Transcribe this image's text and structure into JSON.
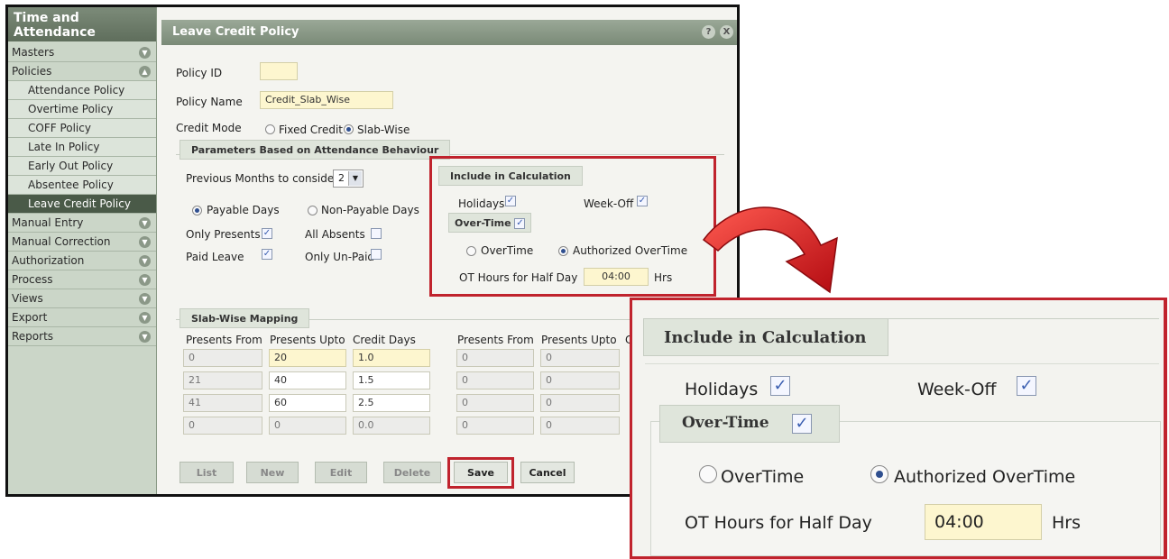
{
  "sidebar": {
    "title": "Time and Attendance",
    "items": [
      {
        "label": "Masters"
      },
      {
        "label": "Policies"
      },
      {
        "label": "Attendance Policy"
      },
      {
        "label": "Overtime Policy"
      },
      {
        "label": "COFF Policy"
      },
      {
        "label": "Late In Policy"
      },
      {
        "label": "Early Out Policy"
      },
      {
        "label": "Absentee Policy"
      },
      {
        "label": "Leave Credit Policy"
      },
      {
        "label": "Manual Entry"
      },
      {
        "label": "Manual Correction"
      },
      {
        "label": "Authorization"
      },
      {
        "label": "Process"
      },
      {
        "label": "Views"
      },
      {
        "label": "Export"
      },
      {
        "label": "Reports"
      }
    ]
  },
  "panel": {
    "title": "Leave Credit Policy",
    "help_icon": "?",
    "close_icon": "X"
  },
  "form": {
    "policy_id_label": "Policy ID",
    "policy_id_value": "",
    "policy_name_label": "Policy Name",
    "policy_name_value": "Credit_Slab_Wise",
    "credit_mode_label": "Credit Mode",
    "fixed_credit": "Fixed Credit",
    "slab_wise": "Slab-Wise"
  },
  "params": {
    "section_title": "Parameters Based on Attendance Behaviour",
    "prev_months_label": "Previous Months to consider",
    "prev_months_value": "2",
    "payable_days": "Payable Days",
    "non_payable_days": "Non-Payable Days",
    "only_presents": "Only Presents",
    "all_absents": "All Absents",
    "paid_leave": "Paid Leave",
    "only_unpaid": "Only Un-Paid"
  },
  "include": {
    "title": "Include in Calculation",
    "holidays": "Holidays",
    "week_off": "Week-Off",
    "overtime_title": "Over-Time",
    "overtime": "OverTime",
    "authorized_overtime": "Authorized OverTime",
    "ot_half_day_label": "OT Hours for Half Day",
    "ot_half_day_value": "04:00",
    "hrs": "Hrs"
  },
  "slab": {
    "section_title": "Slab-Wise Mapping",
    "headers_left": [
      "Presents From",
      "Presents Upto",
      "Credit Days"
    ],
    "headers_right": [
      "Presents From",
      "Presents Upto",
      "C"
    ],
    "rows_left": [
      [
        "0",
        "20",
        "1.0"
      ],
      [
        "21",
        "40",
        "1.5"
      ],
      [
        "41",
        "60",
        "2.5"
      ],
      [
        "0",
        "0",
        "0.0"
      ]
    ],
    "rows_right": [
      [
        "0",
        "0"
      ],
      [
        "0",
        "0"
      ],
      [
        "0",
        "0"
      ],
      [
        "0",
        "0"
      ]
    ]
  },
  "buttons": {
    "list": "List",
    "new": "New",
    "edit": "Edit",
    "delete": "Delete",
    "save": "Save",
    "cancel": "Cancel"
  },
  "colors": {
    "highlight": "#c0232d",
    "arrow": "#d4151c"
  }
}
